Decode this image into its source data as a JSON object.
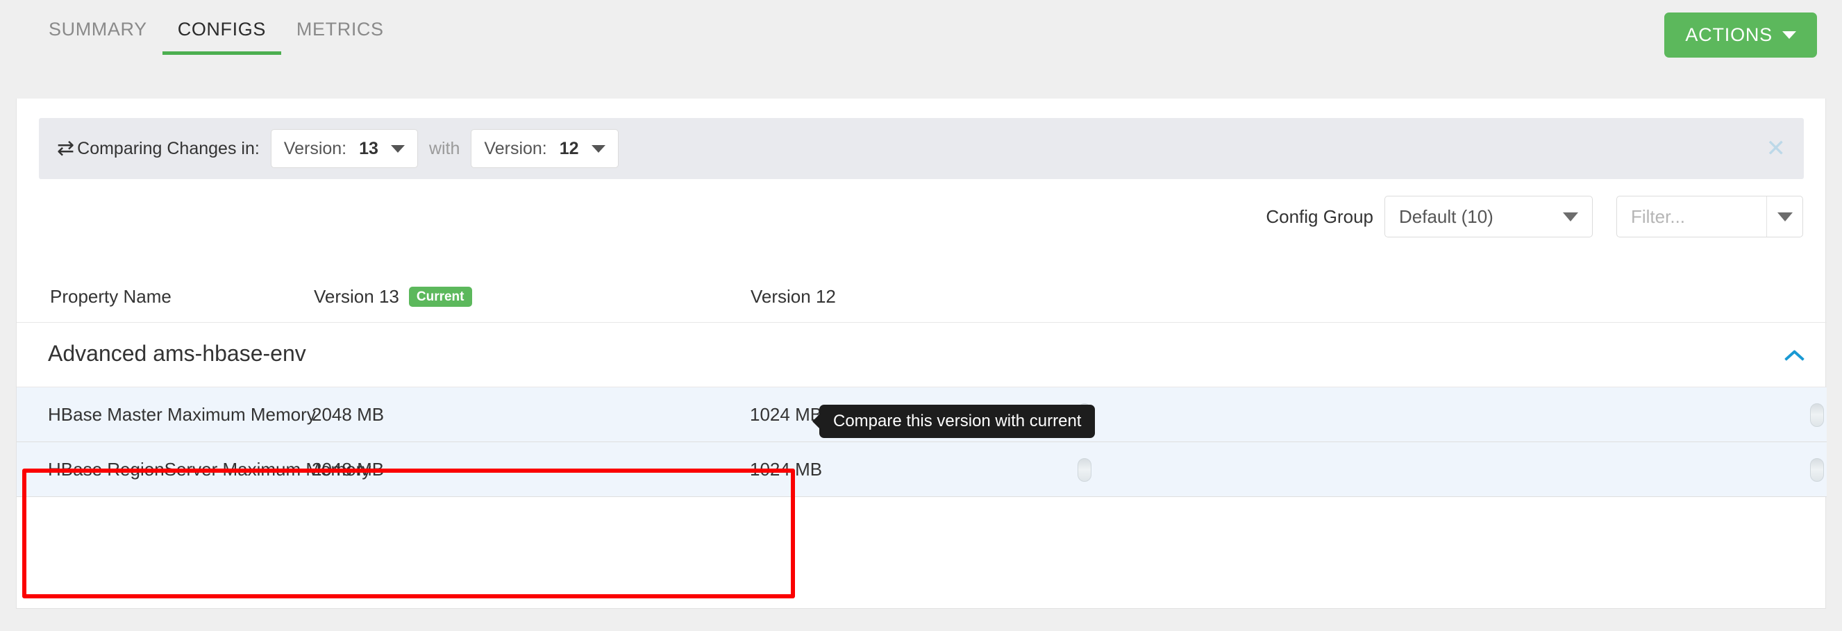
{
  "header": {
    "tabs": [
      {
        "label": "SUMMARY",
        "active": false
      },
      {
        "label": "CONFIGS",
        "active": true
      },
      {
        "label": "METRICS",
        "active": false
      }
    ],
    "actions_button": "ACTIONS",
    "accent_color": "#5cb85c"
  },
  "compare_bar": {
    "icon": "exchange-arrows-icon",
    "icon_glyph": "⇄",
    "label": "Comparing Changes in:",
    "left_version": {
      "label": "Version:",
      "value": "13"
    },
    "conjunction": "with",
    "right_version": {
      "label": "Version:",
      "value": "12"
    },
    "close_glyph": "✕",
    "background": "#e9eaee"
  },
  "filters": {
    "config_group_label": "Config Group",
    "config_group_value": "Default (10)",
    "filter_value": "",
    "filter_placeholder": "Filter..."
  },
  "table": {
    "headers": {
      "property": "Property Name",
      "version_left": "Version 13",
      "version_left_badge": "Current",
      "version_right": "Version 12"
    },
    "section": {
      "title": "Advanced ams-hbase-env",
      "collapse_icon": "chevron-up-icon",
      "collapse_color": "#1999d3"
    },
    "rows": [
      {
        "property": "HBase Master Maximum Memory",
        "version_left": "2048 MB",
        "version_right": "1024 MB"
      },
      {
        "property": "HBase RegionServer Maximum Memory",
        "version_left": "2048 MB",
        "version_right": "1024 MB"
      }
    ]
  },
  "tooltip": {
    "text": "Compare this version with current",
    "background": "#1d1d1d"
  },
  "annotation": {
    "color": "#fb0000"
  }
}
